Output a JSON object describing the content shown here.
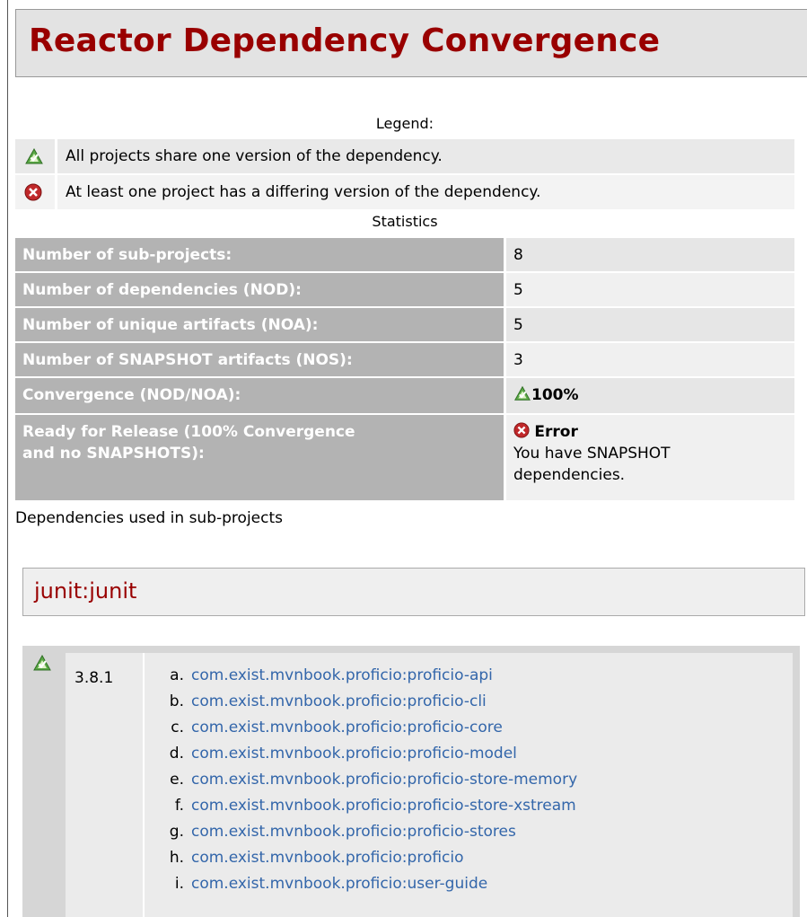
{
  "page": {
    "title": "Reactor Dependency Convergence"
  },
  "legend": {
    "heading": "Legend:",
    "items": [
      {
        "icon": "success-icon",
        "text": "All projects share one version of the dependency."
      },
      {
        "icon": "error-icon",
        "text": "At least one project has a differing version of the dependency."
      }
    ]
  },
  "statistics": {
    "heading": "Statistics",
    "rows": [
      {
        "label": "Number of sub-projects:",
        "value": "8"
      },
      {
        "label": "Number of dependencies (NOD):",
        "value": "5"
      },
      {
        "label": "Number of unique artifacts (NOA):",
        "value": "5"
      },
      {
        "label": "Number of SNAPSHOT artifacts (NOS):",
        "value": "3"
      },
      {
        "label": "Convergence (NOD/NOA):",
        "value": "100%",
        "icon": "success-icon"
      },
      {
        "label_line1": "Ready for Release (100% Convergence",
        "label_line2": "and no SNAPSHOTS):",
        "value": "Error",
        "icon": "error-icon",
        "note_line1": "You have SNAPSHOT",
        "note_line2": "dependencies."
      }
    ]
  },
  "dependencies_caption": "Dependencies used in sub-projects",
  "dependency": {
    "name": "junit:junit",
    "status_icon": "success-icon",
    "version": "3.8.1",
    "projects": [
      {
        "marker": "a.",
        "name": "com.exist.mvnbook.proficio:proficio-api"
      },
      {
        "marker": "b.",
        "name": "com.exist.mvnbook.proficio:proficio-cli"
      },
      {
        "marker": "c.",
        "name": "com.exist.mvnbook.proficio:proficio-core"
      },
      {
        "marker": "d.",
        "name": "com.exist.mvnbook.proficio:proficio-model"
      },
      {
        "marker": "e.",
        "name": "com.exist.mvnbook.proficio:proficio-store-memory"
      },
      {
        "marker": "f.",
        "name": "com.exist.mvnbook.proficio:proficio-store-xstream"
      },
      {
        "marker": "g.",
        "name": "com.exist.mvnbook.proficio:proficio-stores"
      },
      {
        "marker": "h.",
        "name": "com.exist.mvnbook.proficio:proficio"
      },
      {
        "marker": "i.",
        "name": "com.exist.mvnbook.proficio:user-guide"
      }
    ]
  },
  "colors": {
    "title": "#990000",
    "link": "#3366aa",
    "success": "#4a9a3a",
    "error": "#c0282a"
  }
}
